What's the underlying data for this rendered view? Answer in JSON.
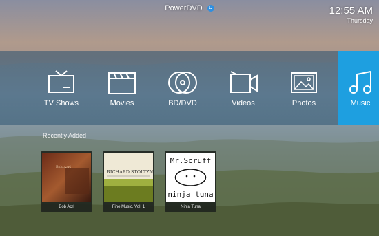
{
  "app": {
    "title": "PowerDVD",
    "badge": "D"
  },
  "clock": {
    "time": "12:55 AM",
    "day": "Thursday"
  },
  "menu": {
    "items": [
      {
        "label": "TV Shows",
        "icon": "tv-icon"
      },
      {
        "label": "Movies",
        "icon": "clapperboard-icon"
      },
      {
        "label": "BD/DVD",
        "icon": "disc-icon"
      },
      {
        "label": "Videos",
        "icon": "video-camera-icon"
      },
      {
        "label": "Photos",
        "icon": "photo-icon"
      },
      {
        "label": "Music",
        "icon": "music-note-icon"
      }
    ],
    "active": "Music",
    "accent": "#1e9fe0"
  },
  "recent": {
    "title": "Recently Added",
    "albums": [
      {
        "caption": "Bob Acri",
        "cover_text": "Bob Acri"
      },
      {
        "caption": "Fine Music, Vol. 1",
        "cover_text": "RICHARD STOLTZMAN"
      },
      {
        "caption": "Ninja Tuna",
        "cover_text_top": "Mr.Scruff",
        "cover_text_bottom": "ninja tuna"
      }
    ]
  }
}
